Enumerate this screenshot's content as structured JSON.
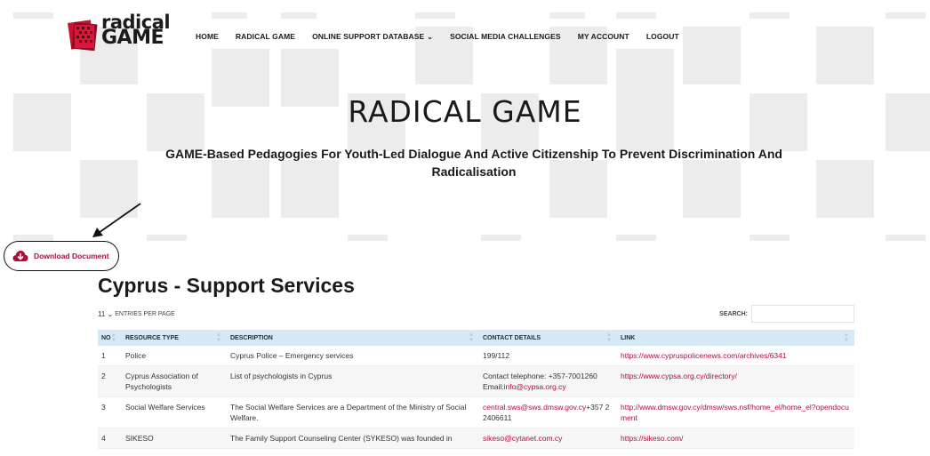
{
  "logo": {
    "line1": "radical",
    "line2": "GAME"
  },
  "nav": {
    "items": [
      {
        "label": "HOME"
      },
      {
        "label": "RADICAL GAME"
      },
      {
        "label": "ONLINE SUPPORT DATABASE",
        "chevron": "chevron-down-icon"
      },
      {
        "label": "SOCIAL MEDIA CHALLENGES"
      },
      {
        "label": "MY ACCOUNT"
      },
      {
        "label": "LOGOUT"
      }
    ]
  },
  "hero": {
    "title": "RADICAL GAME",
    "subtitle": "GAME-Based Pedagogies For Youth-Led Dialogue And Active Citizenship To Prevent Discrimination And Radicalisation"
  },
  "download": {
    "label": "Download Document",
    "icon": "cloud-download-icon"
  },
  "page_title": "Cyprus - Support Services",
  "table_controls": {
    "entries_value": "11",
    "entries_label": "ENTRIES PER PAGE",
    "search_label": "SEARCH:"
  },
  "table": {
    "headers": [
      "NO",
      "RESOURCE TYPE",
      "DESCRIPTION",
      "CONTACT DETAILS",
      "LINK"
    ],
    "rows": [
      {
        "no": "1",
        "type": "Police",
        "description": "Cyprus Police – Emergency services",
        "contact": "199/112",
        "contact_email": "",
        "link": "https://www.cypruspolicenews.com/archives/6341"
      },
      {
        "no": "2",
        "type": "Cyprus Association of Psychologists",
        "description": "List of psychologists in Cyprus",
        "contact": "Contact telephone: +357-7001260 Email:",
        "contact_email": "info@cypsa.org.cy",
        "link": "https://www.cypsa.org.cy/directory/"
      },
      {
        "no": "3",
        "type": "Social Welfare Services",
        "description": "The Social Welfare Services are a Department of the Ministry of Social Welfare.",
        "contact": "",
        "contact_email": "central.sws@sws.dmsw.gov.cy",
        "contact_after": "+357 22406611",
        "link": "http://www.dmsw.gov.cy/dmsw/sws.nsf/home_el/home_el?opendocument"
      },
      {
        "no": "4",
        "type": "SIKESO",
        "description": "The Family Support Counseling Center (SYKESO) was founded in",
        "contact": "",
        "contact_email": "sikeso@cytanet.com.cy",
        "link": "https://sikeso.com/"
      }
    ]
  },
  "colors": {
    "accent": "#b00e3a",
    "header_bg": "#d5e9f4",
    "backdrop": "#ececec"
  }
}
